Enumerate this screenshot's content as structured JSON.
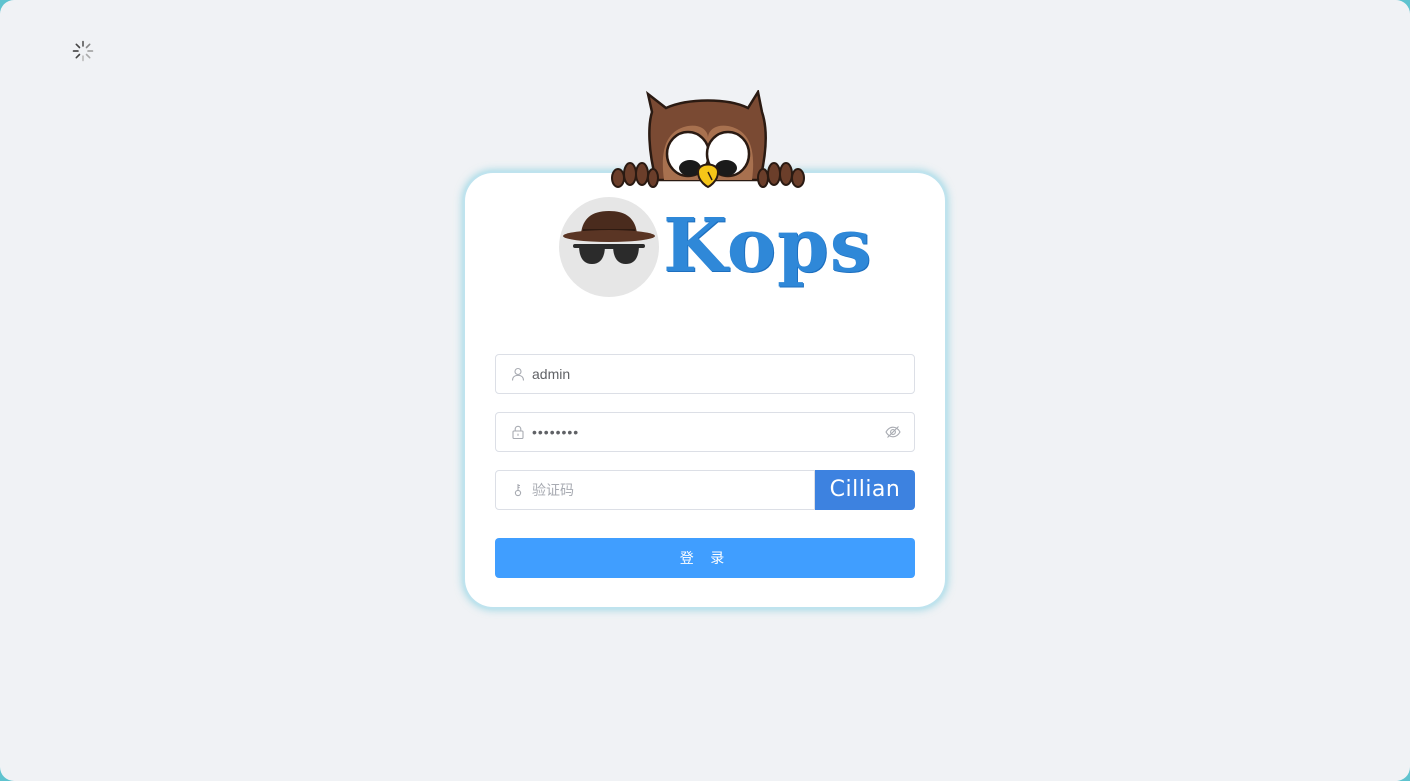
{
  "brand": {
    "name": "Kops"
  },
  "login": {
    "username": {
      "value": "admin",
      "icon": "user-icon"
    },
    "password": {
      "value": "••••••••",
      "icon": "lock-icon",
      "toggle_icon": "eye-hidden-icon"
    },
    "captcha": {
      "placeholder": "验证码",
      "icon": "key-icon",
      "code": "Cillian"
    },
    "submit_label": "登 录"
  },
  "colors": {
    "brand": "#2f88d8",
    "primary_button": "#409eff",
    "captcha_bg": "#3d82e0",
    "page_bg": "#f0f2f5"
  }
}
